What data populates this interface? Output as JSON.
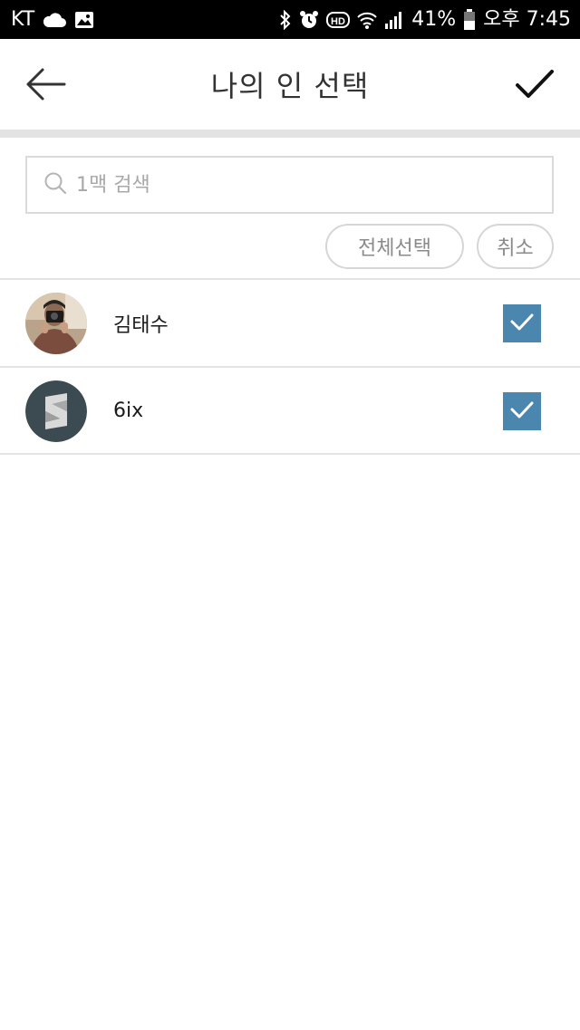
{
  "status_bar": {
    "carrier": "KT",
    "battery": "41%",
    "time": "오후 7:45",
    "icons": [
      "cloud-icon",
      "image-icon",
      "bluetooth-icon",
      "alarm-icon",
      "hd-icon",
      "wifi-icon",
      "signal-icon",
      "battery-icon"
    ]
  },
  "header": {
    "title": "나의 인 선택",
    "back_icon": "arrow-left-icon",
    "confirm_icon": "checkmark-icon"
  },
  "search": {
    "placeholder": "1맥 검색",
    "value": ""
  },
  "actions": {
    "select_all_label": "전체선택",
    "cancel_label": "취소"
  },
  "contacts": [
    {
      "name": "김태수",
      "avatar": "person-photo-avatar",
      "checked": true
    },
    {
      "name": "6ix",
      "avatar": "s-logo-avatar",
      "checked": true
    }
  ],
  "colors": {
    "status_bar": "#000000",
    "accent": "#4a86ad",
    "divider": "#e3e3e3"
  }
}
